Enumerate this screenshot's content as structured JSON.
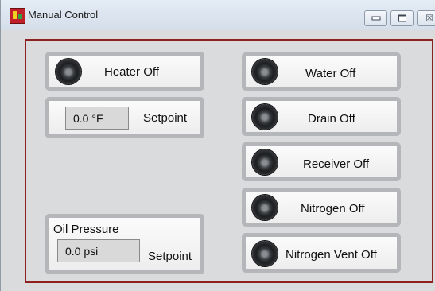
{
  "window": {
    "title": "Manual Control"
  },
  "heater": {
    "label": "Heater Off",
    "setpoint_value": "0.0 °F",
    "setpoint_label": "Setpoint"
  },
  "oil": {
    "title": "Oil Pressure",
    "value": "0.0 psi",
    "setpoint_label": "Setpoint"
  },
  "valves": [
    {
      "label": "Water Off"
    },
    {
      "label": "Drain Off"
    },
    {
      "label": "Receiver Off"
    },
    {
      "label": "Nitrogen Off"
    },
    {
      "label": "Nitrogen Vent Off"
    }
  ]
}
